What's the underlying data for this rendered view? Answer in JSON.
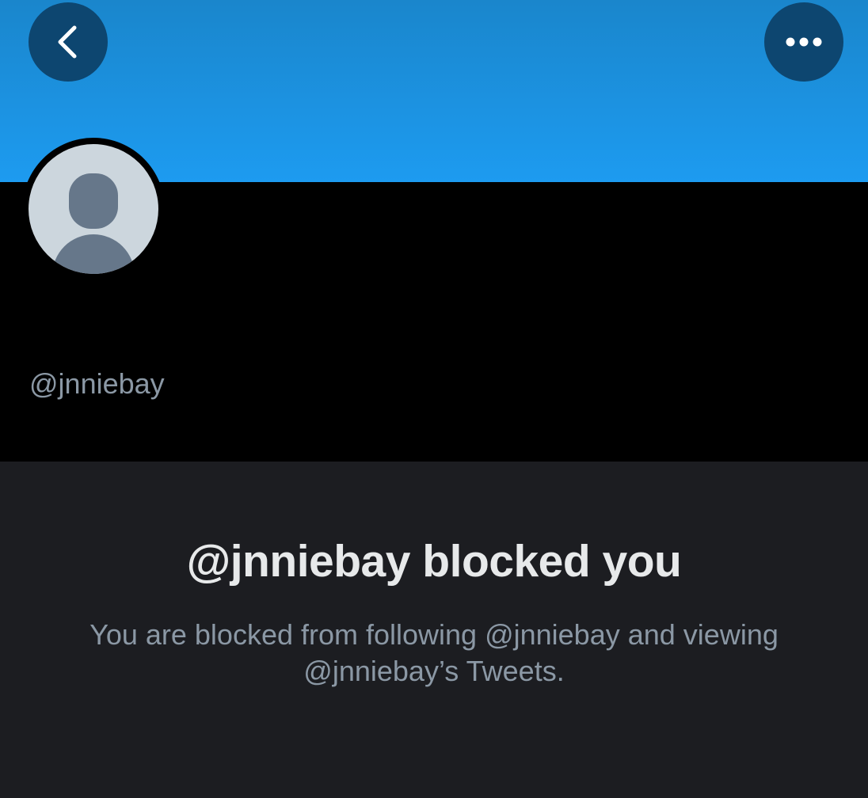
{
  "header": {
    "banner_color": "#1d9bf0",
    "back_icon": "chevron-left-icon",
    "more_icon": "more-horizontal-icon"
  },
  "profile": {
    "avatar_icon": "default-avatar-icon",
    "display_name": "",
    "handle": "@jnniebay"
  },
  "blocked": {
    "title": "@jnniebay blocked you",
    "description": "You are blocked from following @jnniebay and viewing @jnniebay’s Tweets."
  }
}
